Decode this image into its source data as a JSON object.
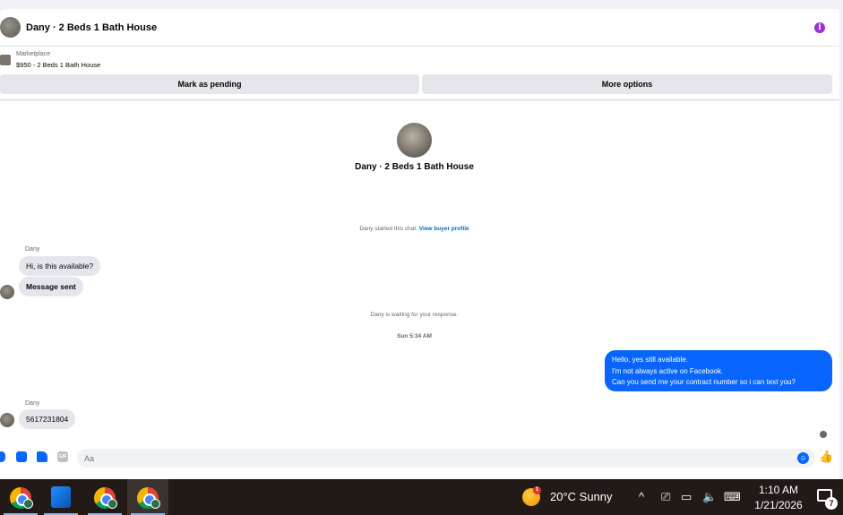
{
  "header": {
    "title": "Dany · 2 Beds 1 Bath House",
    "info_icon": "i"
  },
  "listing": {
    "label": "Marketplace",
    "detail": "$950 - 2 Beds 1 Bath House"
  },
  "actions": {
    "pending_label": "Mark as pending",
    "more_label": "More options"
  },
  "chat_intro": {
    "title": "Dany · 2 Beds 1 Bath House",
    "started_text": "Dany started this chat.",
    "buyer_profile_link": "View buyer profile"
  },
  "messages": {
    "sender_1": "Dany",
    "msg_1": "Hi, is this available?",
    "msg_2": "Message sent",
    "waiting_text": "Dany is waiting for your response.",
    "timestamp": "Sun 5:34 AM",
    "reply_line_1": "Hello, yes  still available.",
    "reply_line_2": "I'm not always active on Facebook.",
    "reply_line_3": "Can you send me your contract number so i can text you?",
    "sender_2": "Dany",
    "msg_3": "5617231804"
  },
  "composer": {
    "placeholder": "Aa",
    "gif_label": "GIF"
  },
  "taskbar": {
    "weather_badge": "1",
    "weather_text": "20°C  Sunny",
    "time": "1:10 AM",
    "date": "1/21/2026",
    "notification_count": "7"
  },
  "colors": {
    "accent": "#0866ff",
    "info": "#9b2ed8",
    "taskbar": "#221a16"
  }
}
